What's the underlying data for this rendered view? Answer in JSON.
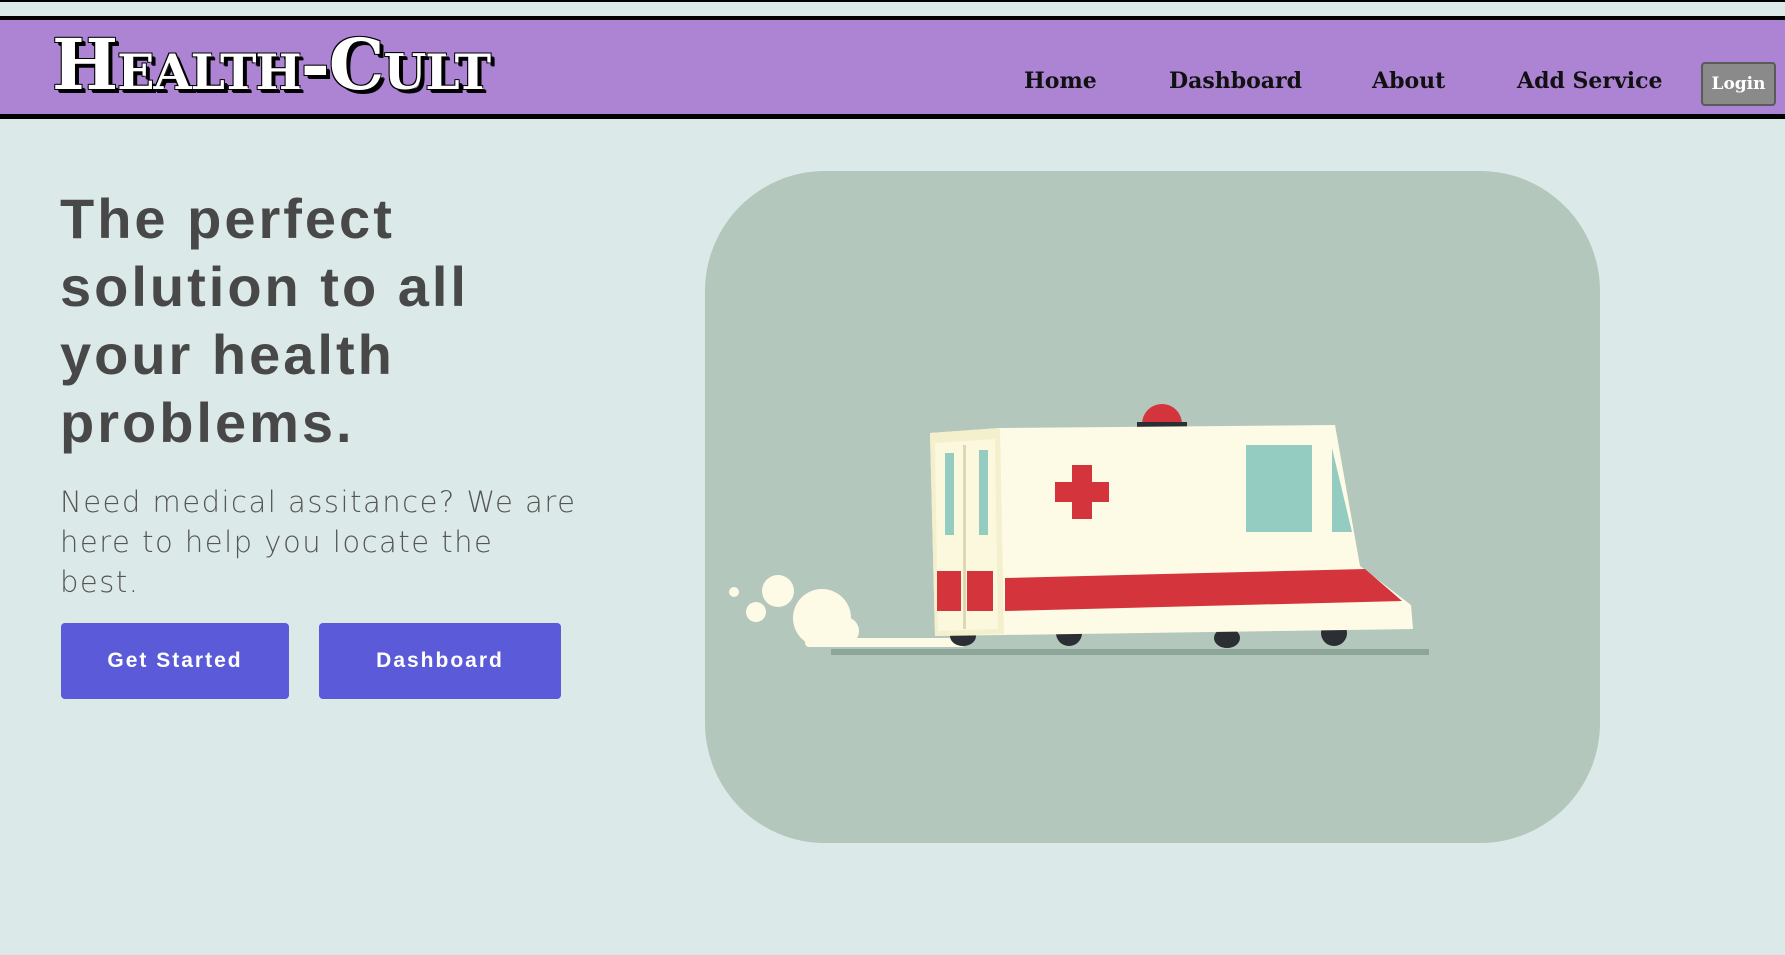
{
  "brand": {
    "logo_text": "Health-Cult",
    "nav_color": "#ad84d4"
  },
  "nav": {
    "items": [
      {
        "label": "Home"
      },
      {
        "label": "Dashboard"
      },
      {
        "label": "About"
      },
      {
        "label": "Add Service"
      }
    ],
    "login_label": "Login"
  },
  "hero": {
    "title": "The perfect solution to all your health problems.",
    "subtitle": "Need medical assitance? We are here to help you locate the best.",
    "buttons": {
      "get_started": "Get Started",
      "dashboard": "Dashboard"
    },
    "button_color": "#5b5bd9",
    "illustration": "ambulance-illustration"
  }
}
